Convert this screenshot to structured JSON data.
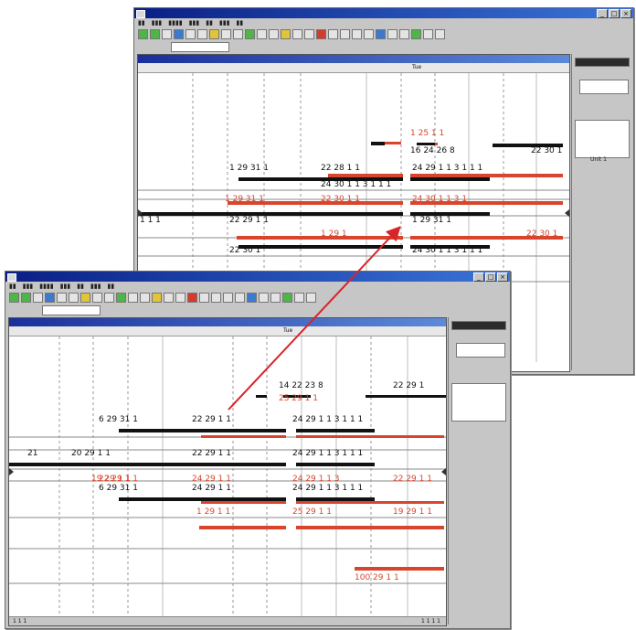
{
  "window_back": {
    "doc_label": "Tue",
    "labels_black": [
      "16 24 26 8",
      "22 30 1",
      "1 29 31 1",
      "22 28 1 1",
      "24 29 1 1 3 1 1 1",
      "22 29 1 1",
      "24 30 1 1 3 1 1 1",
      "1 29 31 1",
      "22 30 1",
      "24 30 1 1 3 1 1 1"
    ],
    "labels_red": [
      "1 25 1 1",
      "1 29 31 1",
      "22 30 1 1",
      "24 30 1 1 3 1",
      "1 29 1",
      "22 30 1"
    ],
    "side_label": "Unit 1",
    "left_cell": "1 1 1"
  },
  "window_front": {
    "doc_label": "Tue",
    "labels_black": [
      "14 22 23 8",
      "22 29 1",
      "6 29 31 1",
      "22 29 1 1",
      "24 29 1 1 3 1 1 1",
      "21",
      "20 29 1 1",
      "22 29 1 1",
      "24 29 1 1 3 1 1 1",
      "6 29 31 1",
      "24 29 1 1",
      "24 29 1 1 3 1 1 1"
    ],
    "labels_red": [
      "25 29 1 1",
      "19 29 1 1",
      "24 29 1 1",
      "24 29 1 1 3",
      "22 29 1 1",
      "1 29 1 1",
      "25 29 1 1",
      "19 29 1 1",
      "22 29 1 1",
      "100 29 1 1"
    ],
    "status_left": "1 1 1",
    "status_right": "1 1 1 1"
  },
  "colors": {
    "accent_red": "#d8452c",
    "bar_black": "#111111",
    "titlebar": "#0a1f86",
    "arrow": "#d8252c"
  },
  "icons": [
    "app-icon",
    "minimize-icon",
    "maximize-icon",
    "close-icon",
    "scroll-left-icon",
    "scroll-right-icon"
  ]
}
